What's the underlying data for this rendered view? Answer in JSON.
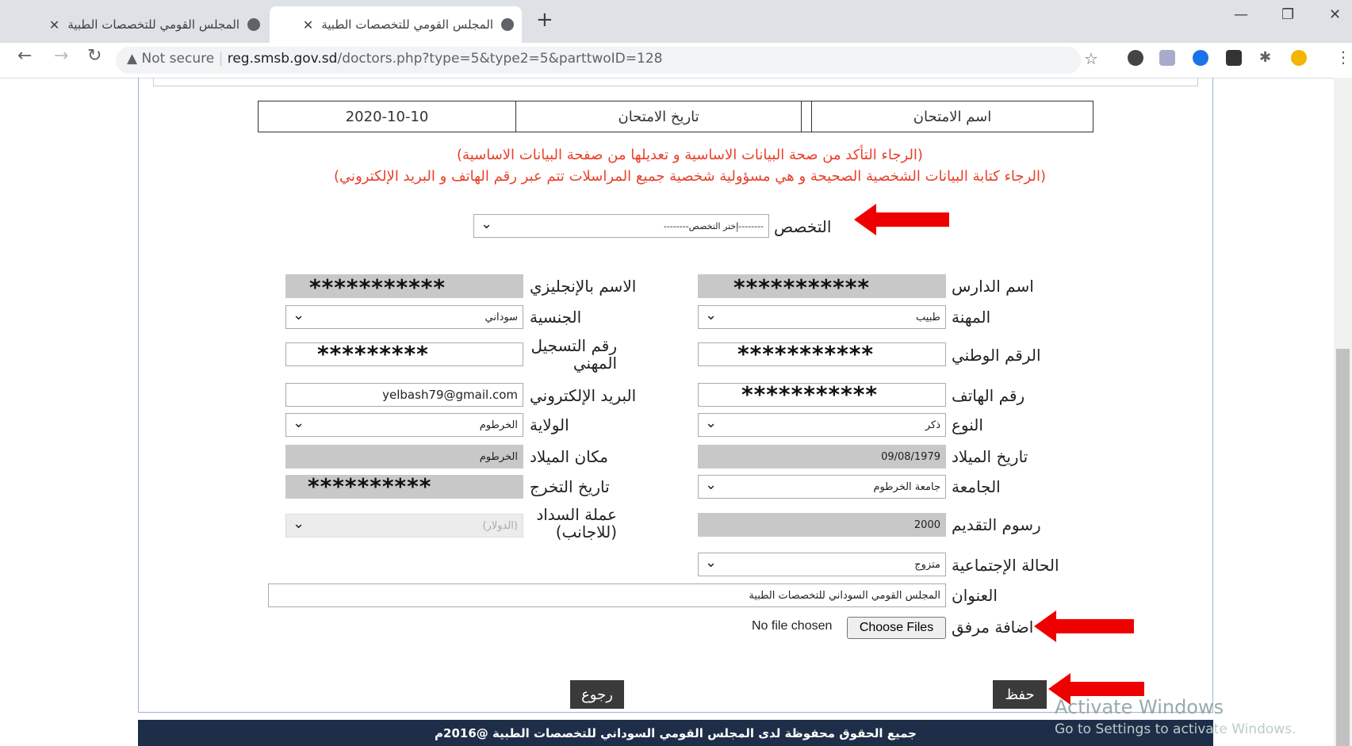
{
  "browser": {
    "tabs": [
      {
        "title": "المجلس القومي للتخصصات الطبية",
        "active": false
      },
      {
        "title": "المجلس القومي للتخصصات الطبية",
        "active": true
      }
    ],
    "security": "Not secure",
    "url_host": "reg.smsb.gov.sd",
    "url_path": "/doctors.php?type=5&type2=5&parttwoID=128"
  },
  "exam_table": {
    "name_label": "اسم الامتحان",
    "date_label": "تاريخ الامتحان",
    "date_value": "2020-10-10"
  },
  "notes": {
    "line1": "(الرجاء التأكد من صحة البيانات الاساسية و تعديلها من صفحة البيانات الاساسية)",
    "line2": "(الرجاء كتابة البيانات الشخصية الصحيحة و هي مسؤولية شخصية جميع المراسلات تتم عبر رقم الهاتف و البريد الإلكتروني)"
  },
  "specialty": {
    "label": "التخصص",
    "placeholder": "--------إختر التخصص--------"
  },
  "form": {
    "student_name": {
      "label": "اسم الدارس",
      "mask": "***********"
    },
    "english_name": {
      "label": "الاسم بالإنجليزي",
      "mask": "***********"
    },
    "profession": {
      "label": "المهنة",
      "value": "طبيب"
    },
    "nationality": {
      "label": "الجنسية",
      "value": "سوداني"
    },
    "national_id": {
      "label": "الرقم الوطني",
      "mask": "***********"
    },
    "reg_number": {
      "label": "رقم التسجيل المهني",
      "mask": "*********"
    },
    "phone": {
      "label": "رقم الهاتف",
      "mask": "***********"
    },
    "email": {
      "label": "البريد الإلكتروني",
      "value": "yelbash79@gmail.com"
    },
    "gender": {
      "label": "النوع",
      "value": "ذكر"
    },
    "state": {
      "label": "الولاية",
      "value": "الخرطوم"
    },
    "birth_date": {
      "label": "تاريخ الميلاد",
      "value": "09/08/1979"
    },
    "birth_place": {
      "label": "مكان الميلاد",
      "value": "الخرطوم"
    },
    "university": {
      "label": "الجامعة",
      "value": "جامعة الخرطوم"
    },
    "grad_date": {
      "label": "تاريخ التخرج",
      "mask": "**********"
    },
    "fees": {
      "label": "رسوم التقديم",
      "value": "2000"
    },
    "currency": {
      "label": "عملة السداد (للاجانب)",
      "value": "(الدولار)"
    },
    "marital": {
      "label": "الحالة الإجتماعية",
      "value": "متزوج"
    },
    "address": {
      "label": "العنوان",
      "value": "المجلس القومي السوداني للتخصصات الطبية"
    },
    "attachment": {
      "label": "اضافة مرفق",
      "button": "Choose Files",
      "status": "No file chosen"
    }
  },
  "buttons": {
    "save": "حفظ",
    "back": "رجوع"
  },
  "footer": "جميع الحقوق محفوظة لدى المجلس القومي السوداني للتخصصات الطبية @2016م",
  "watermark": {
    "line1": "Activate Windows",
    "line2": "Go to Settings to activate Windows."
  }
}
